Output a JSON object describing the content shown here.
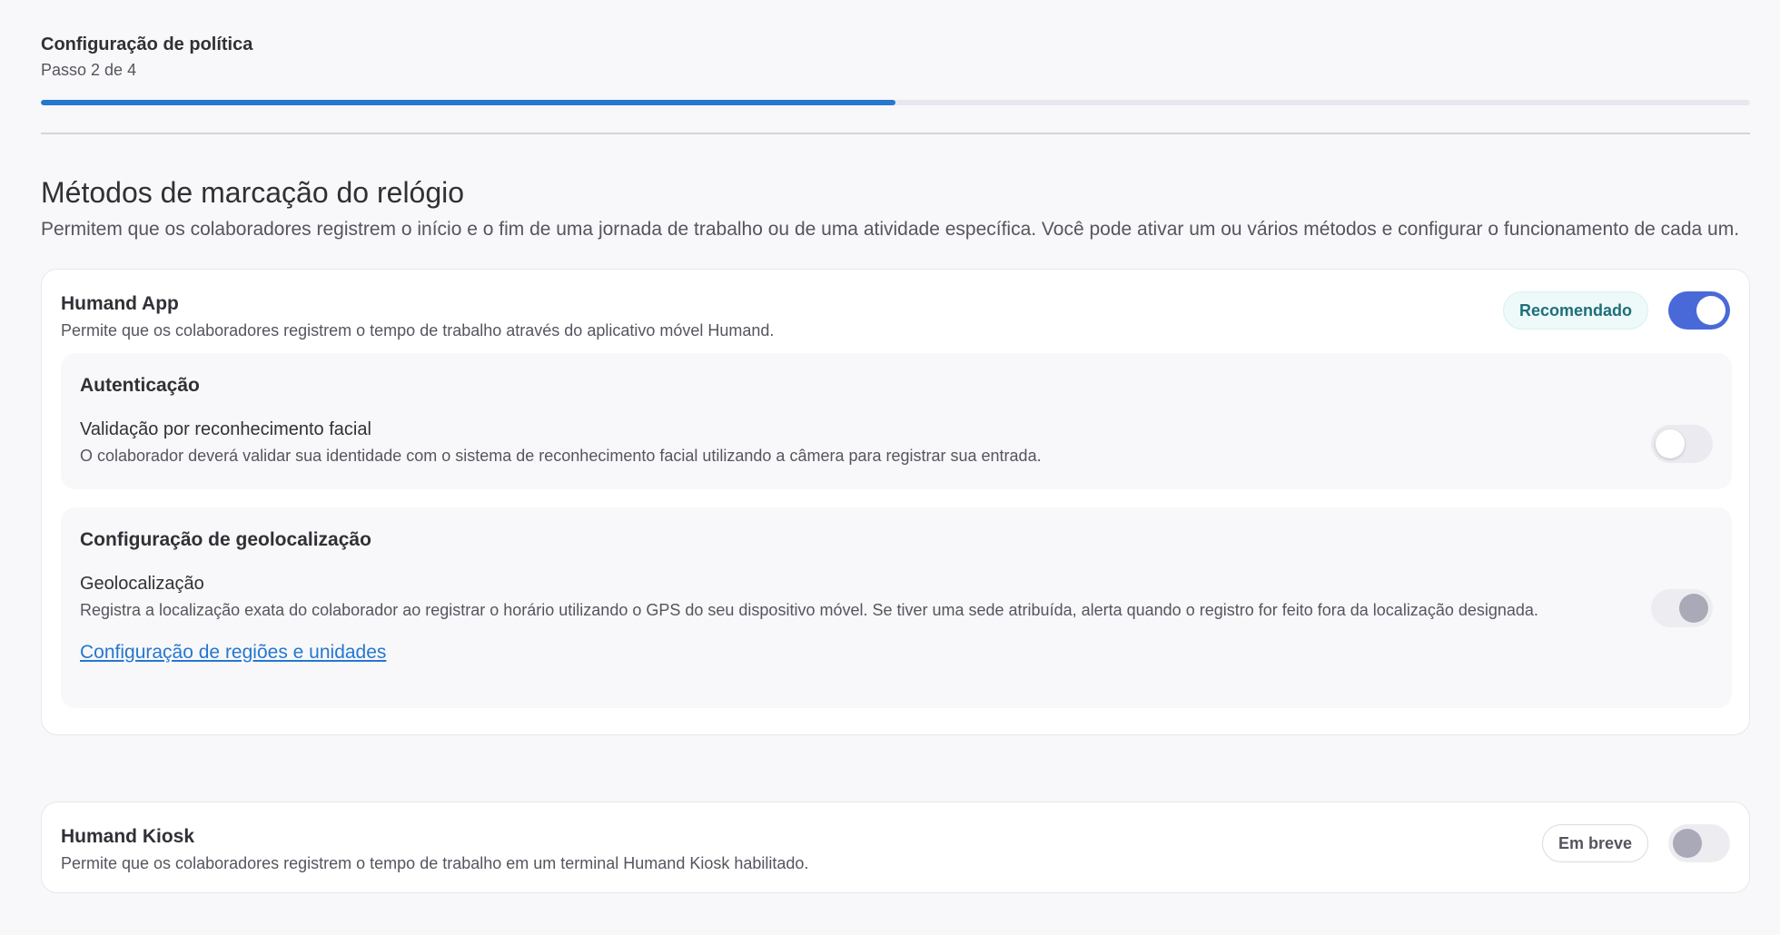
{
  "stepper": {
    "title": "Configuração de política",
    "step_label": "Passo 2 de 4",
    "progress": 0.5
  },
  "section": {
    "title": "Métodos de marcação do relógio",
    "description": "Permitem que os colaboradores registrem o início e o fim de uma jornada de trabalho ou de uma atividade específica. Você pode ativar um ou vários métodos e configurar o funcionamento de cada um."
  },
  "humand_app": {
    "title": "Humand App",
    "description": "Permite que os colaboradores registrem o tempo de trabalho através do aplicativo móvel Humand.",
    "badge": "Recomendado",
    "enabled": true,
    "authentication": {
      "title": "Autenticação",
      "facial": {
        "title": "Validação por reconhecimento facial",
        "description": "O colaborador deverá validar sua identidade com o sistema de reconhecimento facial utilizando a câmera para registrar sua entrada.",
        "enabled": false
      }
    },
    "geolocation": {
      "title": "Configuração de geolocalização",
      "item": {
        "title": "Geolocalização",
        "description": "Registra a localização exata do colaborador ao registrar o horário utilizando o GPS do seu dispositivo móvel. Se tiver uma sede atribuída, alerta quando o registro for feito fora da localização designada.",
        "enabled": true,
        "disabled": true
      },
      "link_label": "Configuração de regiões e unidades"
    }
  },
  "humand_kiosk": {
    "title": "Humand Kiosk",
    "description": "Permite que os colaboradores registrem o tempo de trabalho em um terminal Humand Kiosk habilitado.",
    "badge": "Em breve",
    "enabled": false,
    "disabled": true
  },
  "colors": {
    "accent": "#2577d0",
    "toggle_on": "#4a69d9",
    "recommended_text": "#1d6f7a"
  }
}
